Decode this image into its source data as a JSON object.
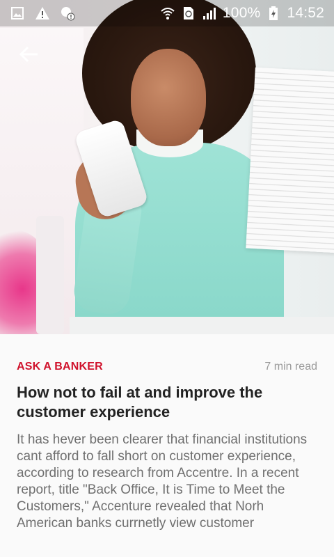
{
  "status_bar": {
    "icons_left": [
      "image-icon",
      "warning-icon",
      "chat-alert-icon"
    ],
    "icons_right": [
      "wifi-icon",
      "sim-icon",
      "signal-icon",
      "battery-icon"
    ],
    "battery": "100%",
    "time": "14:52"
  },
  "header": {
    "back_icon": "back-arrow-icon"
  },
  "article": {
    "category": "ASK A BANKER",
    "read_time": "7 min read",
    "title": "How not to fail at and improve the customer experience",
    "excerpt": "It has hever been clearer that financial institutions cant afford to fall short on customer experience, according to research from Accentre. In a recent report, title \"Back Office, It is Time to Meet the Customers,\" Accenture revealed that Norh American banks currnetly view customer"
  },
  "colors": {
    "accent": "#d0112b",
    "title": "#222222",
    "body_text": "#6f6f6f",
    "meta_text": "#9a9a9a",
    "background": "#fafafa"
  }
}
